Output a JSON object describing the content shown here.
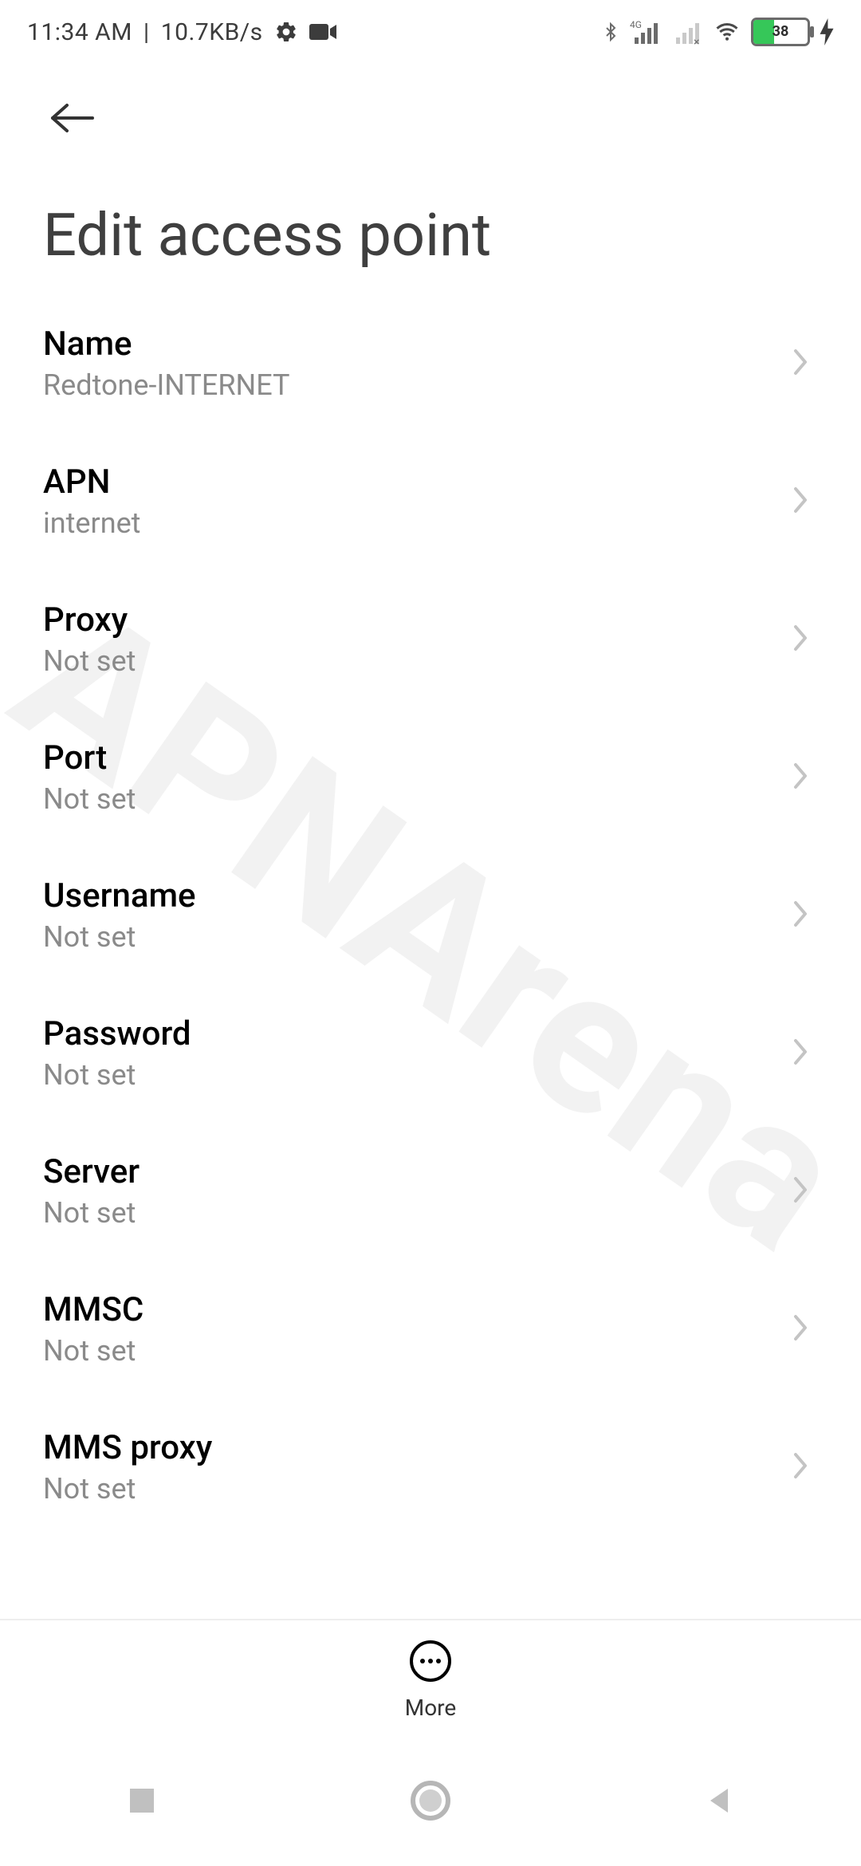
{
  "status": {
    "time": "11:34 AM",
    "net_speed": "10.7KB/s",
    "battery_percent": "38"
  },
  "header": {
    "title": "Edit access point"
  },
  "settings": [
    {
      "label": "Name",
      "value": "Redtone-INTERNET"
    },
    {
      "label": "APN",
      "value": "internet"
    },
    {
      "label": "Proxy",
      "value": "Not set"
    },
    {
      "label": "Port",
      "value": "Not set"
    },
    {
      "label": "Username",
      "value": "Not set"
    },
    {
      "label": "Password",
      "value": "Not set"
    },
    {
      "label": "Server",
      "value": "Not set"
    },
    {
      "label": "MMSC",
      "value": "Not set"
    },
    {
      "label": "MMS proxy",
      "value": "Not set"
    }
  ],
  "bottom": {
    "more_label": "More"
  },
  "watermark": "APNArena"
}
